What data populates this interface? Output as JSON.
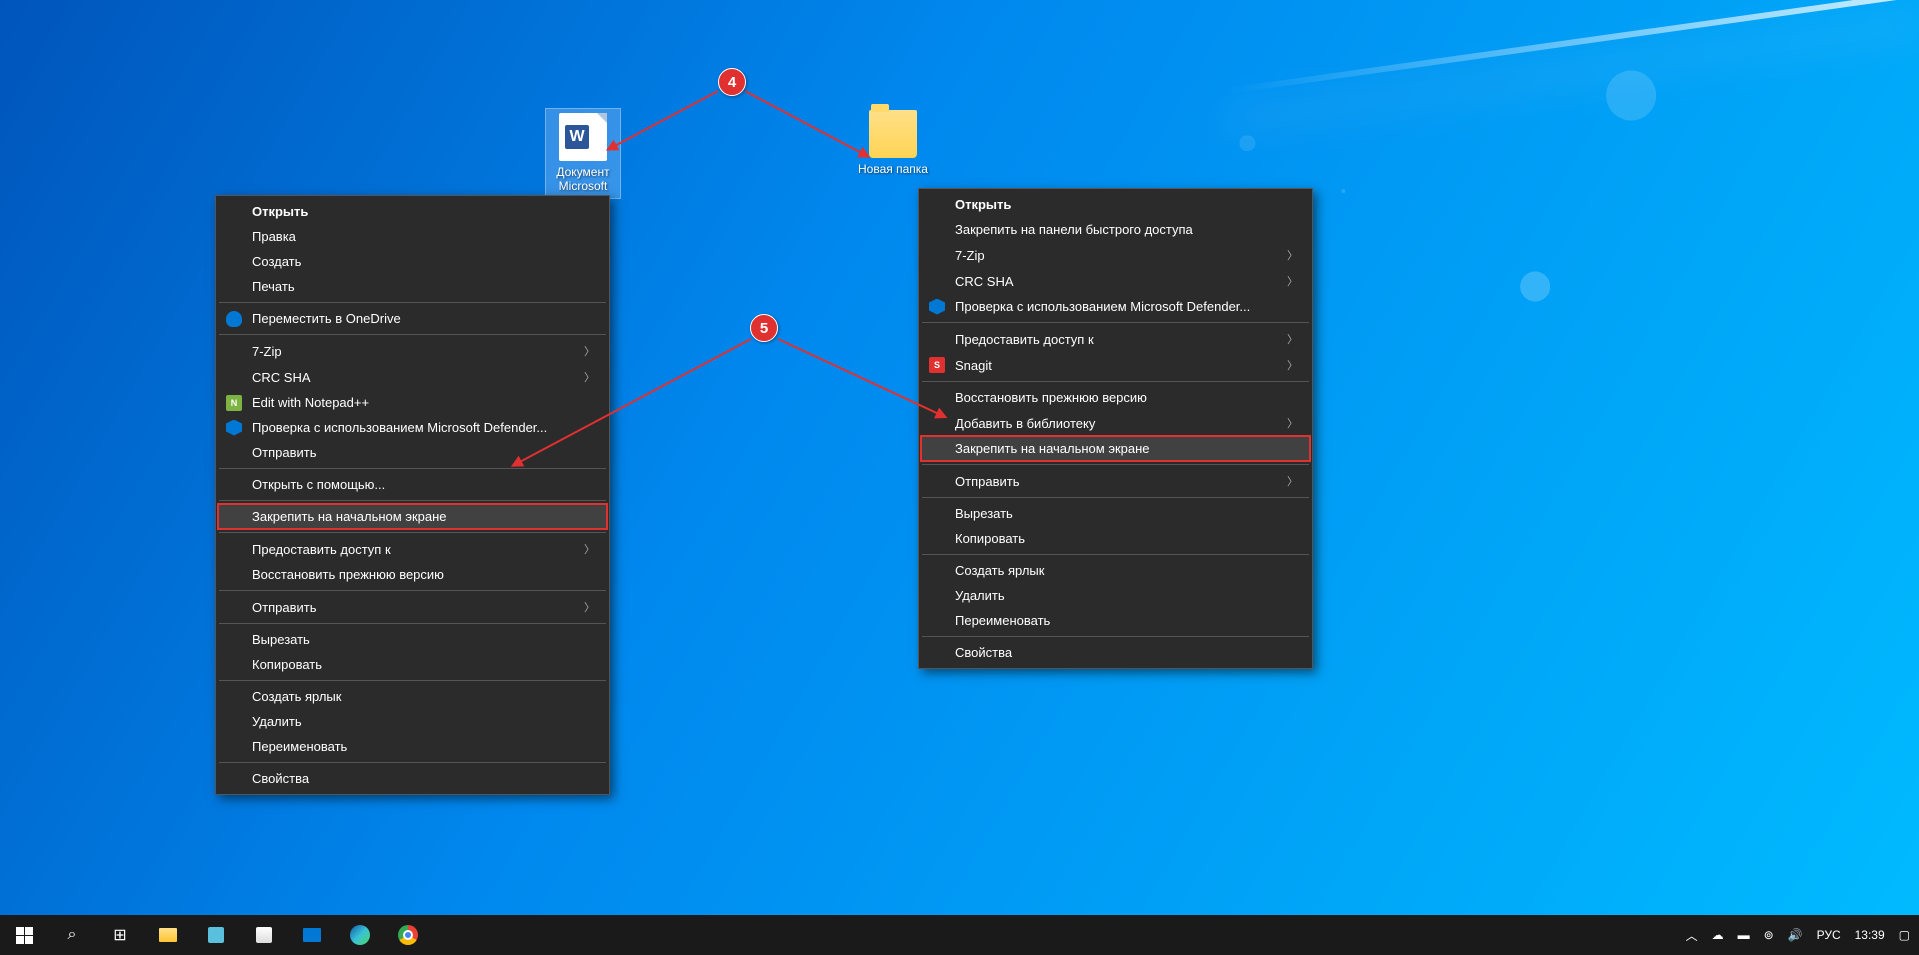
{
  "desktop": {
    "icons": {
      "document": {
        "label": "Документ Microsoft"
      },
      "folder": {
        "label": "Новая папка"
      }
    }
  },
  "callouts": {
    "c4": "4",
    "c5": "5"
  },
  "menu1": {
    "open": "Открыть",
    "edit": "Правка",
    "create": "Создать",
    "print": "Печать",
    "onedrive": "Переместить в OneDrive",
    "sevenzip": "7-Zip",
    "crcsha": "CRC SHA",
    "notepadpp": "Edit with Notepad++",
    "defender": "Проверка с использованием Microsoft Defender...",
    "send": "Отправить",
    "openwith": "Открыть с помощью...",
    "pinstart": "Закрепить на начальном экране",
    "shareaccess": "Предоставить доступ к",
    "restore": "Восстановить прежнюю версию",
    "sendto": "Отправить",
    "cut": "Вырезать",
    "copy": "Копировать",
    "shortcut": "Создать ярлык",
    "delete": "Удалить",
    "rename": "Переименовать",
    "properties": "Свойства"
  },
  "menu2": {
    "open": "Открыть",
    "pinquick": "Закрепить на панели быстрого доступа",
    "sevenzip": "7-Zip",
    "crcsha": "CRC SHA",
    "defender": "Проверка с использованием Microsoft Defender...",
    "shareaccess": "Предоставить доступ к",
    "snagit": "Snagit",
    "restore": "Восстановить прежнюю версию",
    "library": "Добавить в библиотеку",
    "pinstart": "Закрепить на начальном экране",
    "sendto": "Отправить",
    "cut": "Вырезать",
    "copy": "Копировать",
    "shortcut": "Создать ярлык",
    "delete": "Удалить",
    "rename": "Переименовать",
    "properties": "Свойства"
  },
  "taskbar": {
    "lang": "РУС",
    "time": "13:39"
  }
}
